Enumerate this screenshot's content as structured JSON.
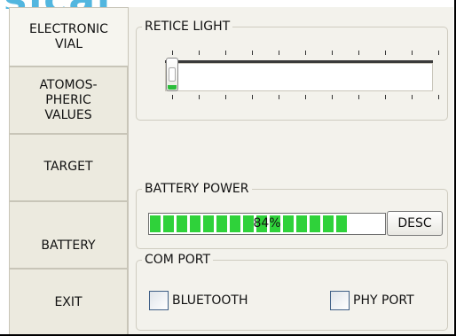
{
  "watermark": {
    "text": "sical"
  },
  "tabs": [
    {
      "label": "ELECTRONIC\nVIAL",
      "active": true
    },
    {
      "label": "ATOMOS-\nPHERIC\nVALUES",
      "active": false
    },
    {
      "label": "TARGET",
      "active": false
    },
    {
      "label": "BATTERY",
      "active": false
    },
    {
      "label": "EXIT",
      "active": false
    }
  ],
  "reticle": {
    "label": "RETICE LIGHT",
    "slider_value": 0
  },
  "battery": {
    "label": "BATTERY POWER",
    "percent_text": "84%",
    "level": 0.84,
    "button_label": "DESC"
  },
  "com_port": {
    "label": "COM PORT",
    "bluetooth_label": "BLUETOOTH",
    "bluetooth_checked": false,
    "phy_port_label": "PHY PORT",
    "phy_port_checked": false
  },
  "colors": {
    "progress_fill": "#2fd23a",
    "watermark": "#52b6df",
    "slider_grip": "#2bbd3b"
  }
}
